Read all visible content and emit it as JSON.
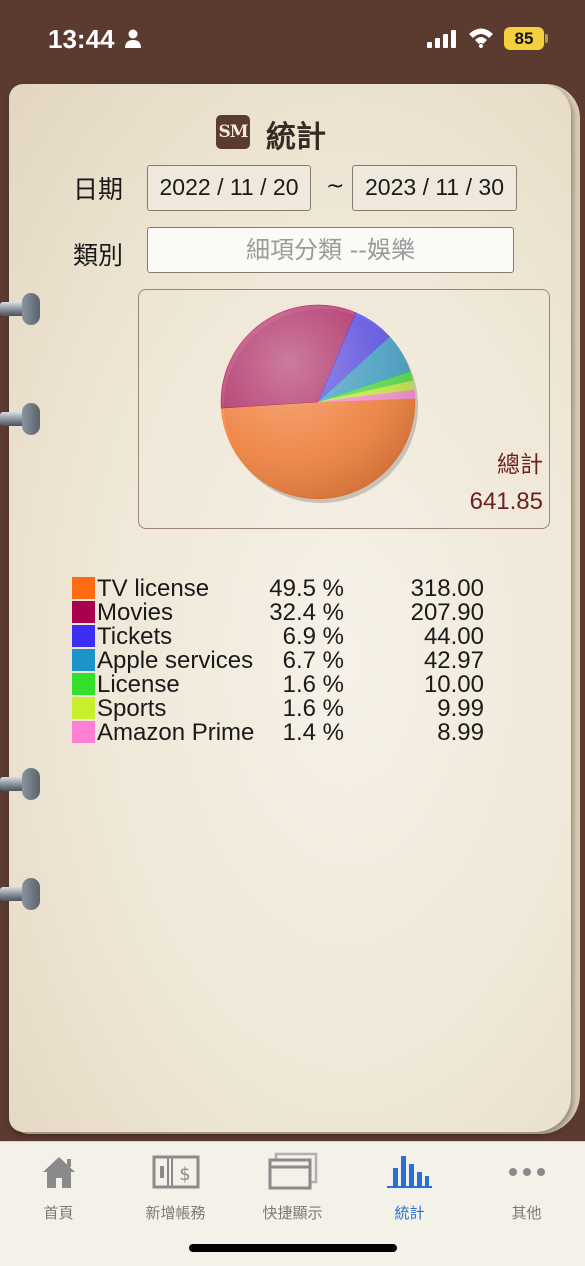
{
  "status": {
    "time": "13:44",
    "battery": "85"
  },
  "header": {
    "logo_text": "SM",
    "title": "統計"
  },
  "filters": {
    "date_label": "日期",
    "start_date": "2022 / 11 / 20",
    "separator": "~",
    "end_date": "2023 / 11 / 30",
    "category_label": "類別",
    "category_value": "細項分類 --娛樂"
  },
  "summary": {
    "total_label": "總計",
    "total_value": "641.85"
  },
  "chart_data": {
    "type": "pie",
    "categories": [
      "TV license",
      "Movies",
      "Tickets",
      "Apple services",
      "License",
      "Sports",
      "Amazon Prime"
    ],
    "values": [
      318.0,
      207.9,
      44.0,
      42.97,
      10.0,
      9.99,
      8.99
    ],
    "percentages": [
      49.5,
      32.4,
      6.9,
      6.7,
      1.6,
      1.6,
      1.4
    ],
    "colors": [
      "#ff6a13",
      "#a8004f",
      "#3b2ef0",
      "#1d94c9",
      "#33e02c",
      "#c8ef2c",
      "#ff7fd4"
    ]
  },
  "legend": [
    {
      "name": "TV license",
      "pct": "49.5 %",
      "amount": "318.00",
      "color": "#ff6a13"
    },
    {
      "name": "Movies",
      "pct": "32.4 %",
      "amount": "207.90",
      "color": "#a8004f"
    },
    {
      "name": "Tickets",
      "pct": "6.9 %",
      "amount": "44.00",
      "color": "#3b2ef0"
    },
    {
      "name": "Apple services",
      "pct": "6.7 %",
      "amount": "42.97",
      "color": "#1d94c9"
    },
    {
      "name": "License",
      "pct": "1.6 %",
      "amount": "10.00",
      "color": "#33e02c"
    },
    {
      "name": "Sports",
      "pct": "1.6 %",
      "amount": "9.99",
      "color": "#c8ef2c"
    },
    {
      "name": "Amazon Prime",
      "pct": "1.4 %",
      "amount": "8.99",
      "color": "#ff7fd4"
    }
  ],
  "tabs": [
    {
      "label": "首頁",
      "icon": "home-icon"
    },
    {
      "label": "新增帳務",
      "icon": "add-entry-icon"
    },
    {
      "label": "快捷顯示",
      "icon": "quick-view-icon"
    },
    {
      "label": "統計",
      "icon": "stats-icon",
      "active": true
    },
    {
      "label": "其他",
      "icon": "more-icon"
    }
  ],
  "colors": {
    "accent": "#2a6fd6",
    "frame": "#5b3a30",
    "total_text": "#6e1f1f"
  }
}
